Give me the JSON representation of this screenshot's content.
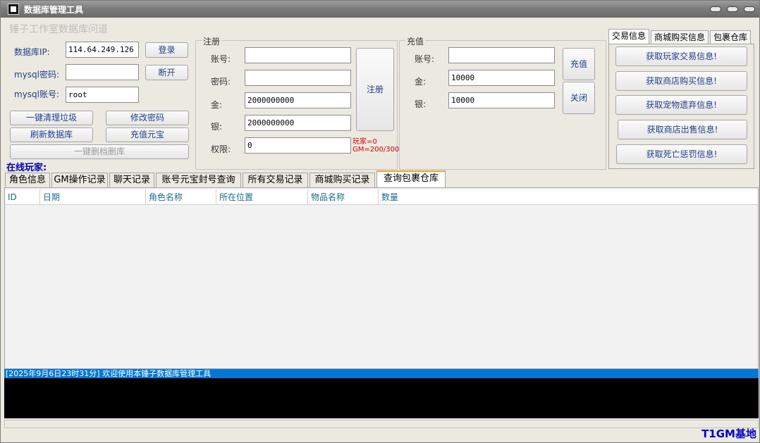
{
  "window": {
    "title": "数据库管理工具"
  },
  "watermark": "锤子工作室数据库问道",
  "db": {
    "ip_label": "数据库IP:",
    "ip_value": "114.64.249.126",
    "pwd_label": "mysql密码:",
    "pwd_value": "",
    "user_label": "mysql账号:",
    "user_value": "root",
    "login_btn": "登录",
    "disconnect_btn": "断开",
    "clean_btn": "一键清理垃圾",
    "change_pwd_btn": "修改密码",
    "refresh_btn": "刷新数据库",
    "recharge_yb_btn": "充值元宝",
    "wipe_btn": "一键删档删库"
  },
  "register": {
    "legend": "注册",
    "account_label": "账号:",
    "account_value": "",
    "password_label": "密码:",
    "password_value": "",
    "gold_label": "金:",
    "gold_value": "2000000000",
    "silver_label": "银:",
    "silver_value": "2000000000",
    "perm_label": "权限:",
    "perm_value": "0",
    "hint_line1": "玩家=0",
    "hint_line2": "GM=200/300",
    "submit_btn": "注册"
  },
  "recharge": {
    "legend": "充值",
    "account_label": "账号:",
    "account_value": "",
    "gold_label": "金:",
    "gold_value": "10000",
    "silver_label": "银:",
    "silver_value": "10000",
    "recharge_btn": "充值",
    "close_btn": "关闭"
  },
  "right_tabs": {
    "tabs": [
      "交易信息",
      "商城购买信息",
      "包裹仓库"
    ],
    "active": 0,
    "buttons": [
      "获取玩家交易信息!",
      "获取商店购买信息!",
      "获取宠物遗弃信息!",
      "获取商店出售信息!",
      "获取死亡惩罚信息!"
    ]
  },
  "online_label": "在线玩家:",
  "main_tabs": {
    "tabs": [
      "角色信息",
      "GM操作记录",
      "聊天记录",
      "账号元宝封号查询",
      "所有交易记录",
      "商城购买记录",
      "查询包裹仓库"
    ],
    "active": 6
  },
  "table": {
    "columns": [
      "ID",
      "日期",
      "角色名称",
      "所在位置",
      "物品名称",
      "数量"
    ]
  },
  "log": {
    "line": "[2025年9月6日23时31分]    欢迎使用本锤子数据库管理工具"
  },
  "brand": "T1GM基地"
}
